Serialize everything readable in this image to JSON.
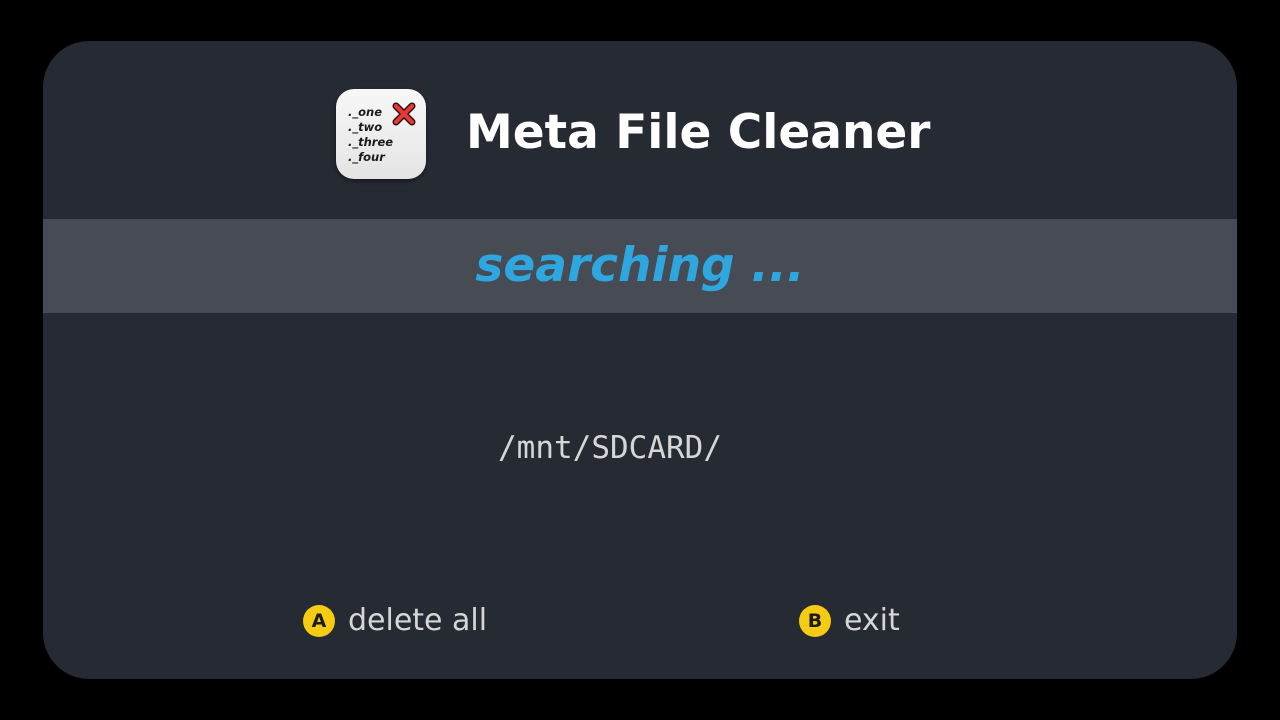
{
  "app": {
    "title": "Meta File Cleaner",
    "icon": {
      "name": "meta-file-cleaner-app-icon",
      "lines": "._one\n._two\n._three\n._four",
      "mark": "red-x-icon"
    }
  },
  "status": {
    "text": "searching ..."
  },
  "scan": {
    "current_path": "/mnt/SDCARD/"
  },
  "controls": {
    "a": {
      "button": "A",
      "label": "delete all"
    },
    "b": {
      "button": "B",
      "label": "exit"
    }
  },
  "colors": {
    "background": "#000000",
    "panel": "#262a32",
    "status_bar": "#474b54",
    "accent": "#2ea6e0",
    "button_badge": "#f5cc13",
    "text_primary": "#ffffff",
    "text_secondary": "#d6d6d6",
    "x_mark": "#e53935"
  }
}
